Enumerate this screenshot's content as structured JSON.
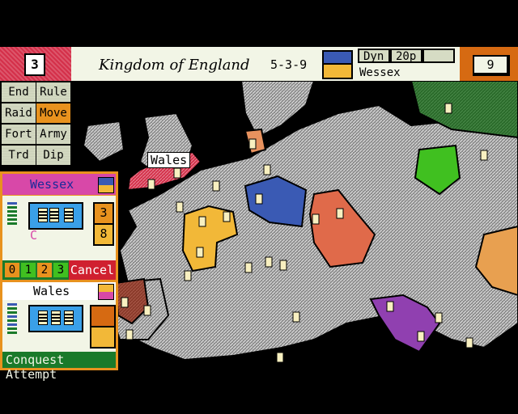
{
  "top_bar": {
    "turn": "3",
    "kingdom": "Kingdom of England",
    "date": "5-3-9",
    "chips": [
      "Dyn",
      "20p",
      ""
    ],
    "realm": "Wessex",
    "score": "9"
  },
  "commands": [
    "End",
    "Rule",
    "Raid",
    "Move",
    "Fort",
    "Army",
    "Trd",
    "Dip"
  ],
  "active_command": "Move",
  "attacker": {
    "name": "Wessex",
    "value_top": "3",
    "value_bottom": "8",
    "marker": "C",
    "numbers": [
      "0",
      "1",
      "2",
      "3"
    ],
    "cancel_label": "Cancel"
  },
  "defender": {
    "name": "Wales"
  },
  "footer": "Conquest Attempt",
  "map": {
    "label": "Wales"
  },
  "colors": {
    "wessex": "#f2b838",
    "wales": "#d4304a",
    "panel": "#e8921e",
    "green": "#1a7a2a",
    "blue": "#3a5ab4",
    "purple": "#9040b0"
  }
}
